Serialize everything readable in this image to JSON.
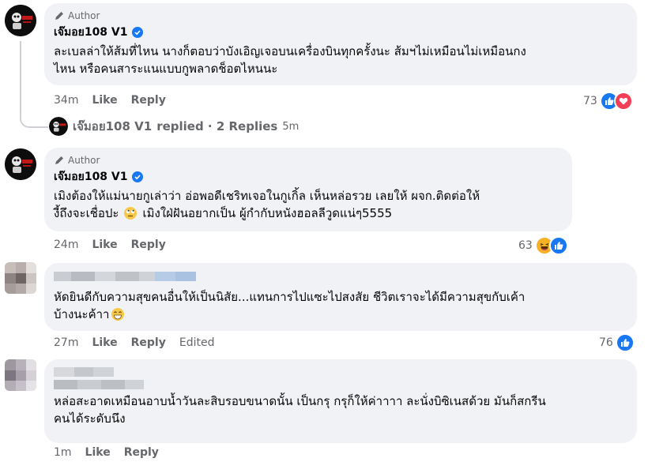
{
  "comments": [
    {
      "badge": "Author",
      "name": "เจ๊มอย108 V1",
      "line1": "ละเบลล่าให้ส้มที่ไหน นางก็ตอบว่าบังเอิญเจอบนเครื่องบินทุกครั้งนะ ส้มฯไม่เหมือนไม่เหมือนกง",
      "line2": "ไหน หรือคนสาระแนแบบกูพลาดช็อตไหนนะ",
      "time": "34m",
      "like": "Like",
      "reply": "Reply",
      "count": "73",
      "reactions": [
        "like-icon",
        "love-icon"
      ]
    },
    {
      "badge": "Author",
      "name": "เจ๊มอย108 V1",
      "line1": "เมิงต้องให้แม่นายกูเล่าว่า อ่อพอดีเชริทเจอในกูเกิ้ล เห็นหล่อรวย เลยให้ ผจก.ติดต่อให้",
      "line2a": "งี้ถึงจะเชื่อปะ",
      "line2b": "เมิงใฝ่ฝันอยากเป็น ผู้กำกับหนังฮอลลีวูดแน่ๆ5555",
      "time": "24m",
      "like": "Like",
      "reply": "Reply",
      "count": "63",
      "reactions": [
        "haha-icon",
        "like-icon"
      ]
    },
    {
      "line1": "หัดยินดีกับความสุขคนอื่นให้เป็นนิสัย...แทนการไปแซะไปสงสัย ชีวิตเราจะได้มีความสุขกับเค้า",
      "line2": "บ้างนะค้าา",
      "time": "27m",
      "like": "Like",
      "reply": "Reply",
      "edited": "Edited",
      "count": "76",
      "reactions": [
        "like-icon"
      ]
    },
    {
      "line1": "หล่อสะอาดเหมือนอาบน้ำวันละสิบรอบขนาดนั้น เป็นกรุ กรุก็ให้ค่าาาา ละนั่งบิซิเนสด้วย มันก็สกรีน",
      "line2": "คนได้ระดับนึง",
      "time": "1m",
      "like": "Like",
      "reply": "Reply"
    }
  ],
  "replies_summary": {
    "name": "เจ๊มอย108 V1",
    "text": "replied · 2 Replies",
    "ago": "5m"
  },
  "colors": {
    "bubble": "#f0f2f5",
    "like": "#1877f2",
    "love": "#f33e58",
    "haha": "#f7b125",
    "muted": "#65676b"
  }
}
